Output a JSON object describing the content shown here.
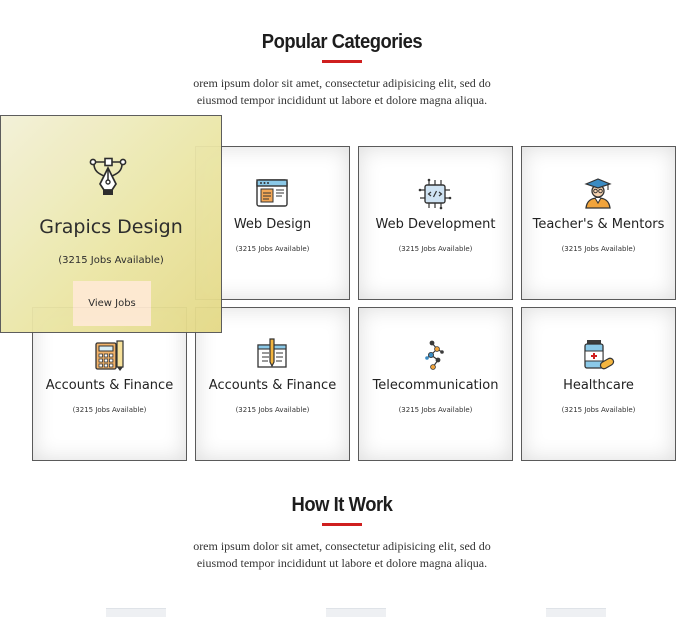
{
  "popular": {
    "title": "Popular Categories",
    "lead_line1": "orem ipsum dolor sit amet, consectetur adipisicing elit, sed do",
    "lead_line2": "eiusmod tempor incididunt ut labore et dolore magna aliqua."
  },
  "hovered_category": {
    "icon": "pen-tool-icon",
    "title": "Grapics Design",
    "jobs": "(3215 Jobs Available)",
    "button_label": "View Jobs"
  },
  "categories": [
    {
      "icon": "web-browser-icon",
      "title": "Web Design",
      "jobs": "(3215 Jobs Available)"
    },
    {
      "icon": "code-chip-icon",
      "title": "Web Development",
      "jobs": "(3215 Jobs Available)"
    },
    {
      "icon": "graduate-teacher-icon",
      "title": "Teacher's & Mentors",
      "jobs": "(3215 Jobs Available)"
    },
    {
      "icon": "calculator-icon",
      "title": "Accounts & Finance",
      "jobs": "(3215 Jobs Available)"
    },
    {
      "icon": "document-pencil-icon",
      "title": "Accounts & Finance",
      "jobs": "(3215 Jobs Available)"
    },
    {
      "icon": "network-satellite-icon",
      "title": "Telecommunication",
      "jobs": "(3215 Jobs Available)"
    },
    {
      "icon": "medicine-icon",
      "title": "Healthcare",
      "jobs": "(3215 Jobs Available)"
    }
  ],
  "how_it_work": {
    "title": "How It Work",
    "lead_line1": "orem ipsum dolor sit amet, consectetur adipisicing elit, sed do",
    "lead_line2": "eiusmod tempor incididunt ut labore et dolore magna aliqua."
  },
  "colors": {
    "accent": "#cf1f1f",
    "hover_bg": "#ebe6a6",
    "button_bg": "#fde8cf"
  }
}
